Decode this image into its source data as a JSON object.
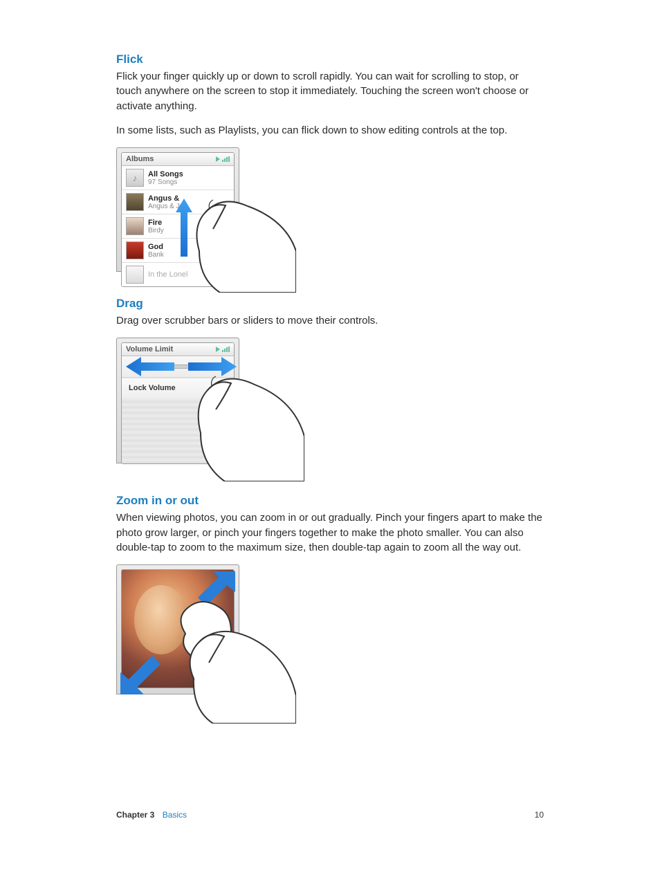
{
  "sections": {
    "flick": {
      "title": "Flick",
      "p1": "Flick your finger quickly up or down to scroll rapidly. You can wait for scrolling to stop, or touch anywhere on the screen to stop it immediately. Touching the screen won't choose or activate anything.",
      "p2": "In some lists, such as Playlists, you can flick down to show editing controls at the top.",
      "device": {
        "title": "Albums",
        "rows": [
          {
            "title": "All Songs",
            "sub": "97 Songs"
          },
          {
            "title": "Angus &",
            "sub": "Angus & Ju"
          },
          {
            "title": "Fire",
            "sub": "Birdy"
          },
          {
            "title": "God",
            "sub": "Bank"
          },
          {
            "title": "In the Lonel",
            "sub": ""
          }
        ]
      }
    },
    "drag": {
      "title": "Drag",
      "p1": "Drag over scrubber bars or sliders to move their controls.",
      "device": {
        "title": "Volume Limit",
        "lock": "Lock Volume"
      }
    },
    "zoom": {
      "title": "Zoom in or out",
      "p1": "When viewing photos, you can zoom in or out gradually. Pinch your fingers apart to make the photo grow larger, or pinch your fingers together to make the photo smaller. You can also double-tap to zoom to the maximum size, then double-tap again to zoom all the way out."
    }
  },
  "footer": {
    "chapter_label": "Chapter  3",
    "chapter_title": "Basics",
    "page": "10"
  }
}
